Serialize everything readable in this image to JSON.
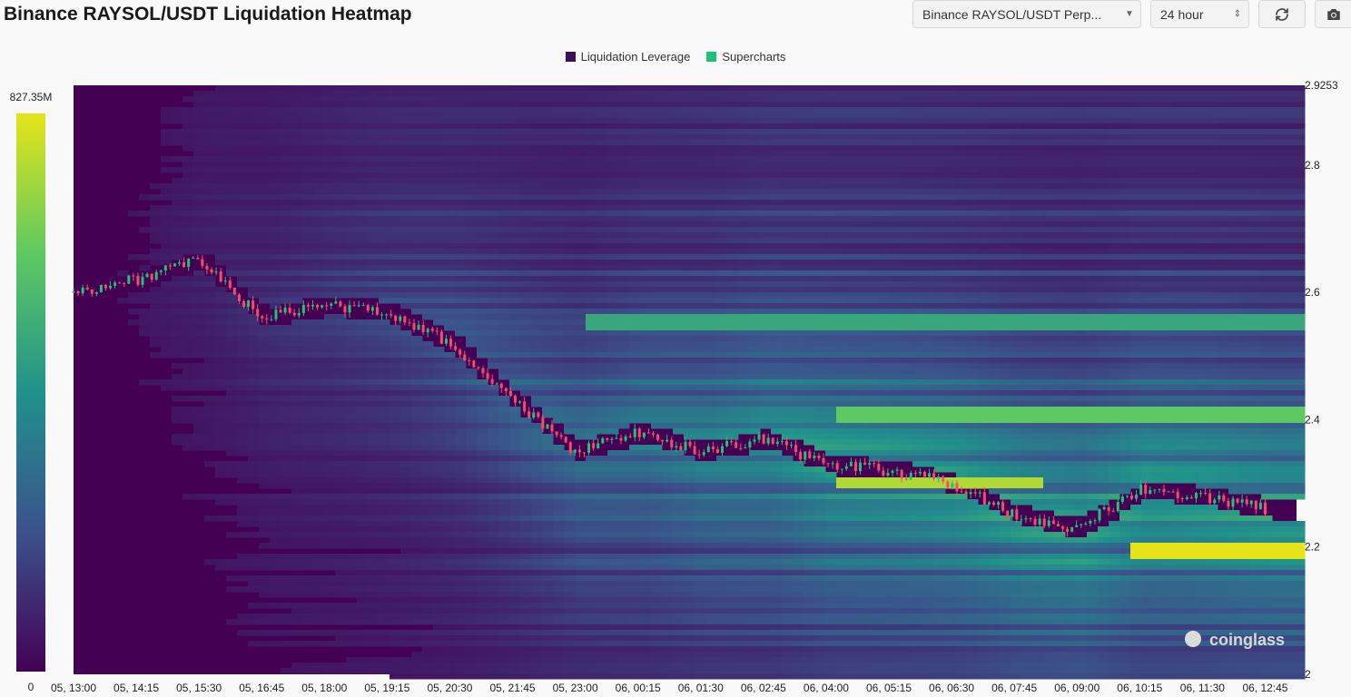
{
  "page_title": "Binance RAYSOL/USDT Liquidation Heatmap",
  "controls": {
    "pair_select": "Binance RAYSOL/USDT Perp...",
    "range_select": "24 hour",
    "refresh_icon": "refresh-icon",
    "camera_icon": "camera-icon"
  },
  "watermark": "coinglass",
  "colors": {
    "legend_leverage": "#3b0f5c",
    "legend_supercharts": "#1ec27a",
    "heat_low": "#440154",
    "heat_high": "#e6e419",
    "candle_up": "#25c07a",
    "candle_down": "#ef4f6d"
  },
  "chart_data": {
    "type": "heatmap",
    "title": "Binance RAYSOL/USDT Liquidation Heatmap",
    "legend": [
      "Liquidation Leverage",
      "Supercharts"
    ],
    "legend_position": "top-center",
    "colorbar": {
      "min_label": "0",
      "max_label": "827.35M",
      "min": 0,
      "max": 827350000
    },
    "x_ticks": [
      "05, 13:00",
      "05, 14:15",
      "05, 15:30",
      "05, 16:45",
      "05, 18:00",
      "05, 19:15",
      "05, 20:30",
      "05, 21:45",
      "05, 23:00",
      "06, 00:15",
      "06, 01:30",
      "06, 02:45",
      "06, 04:00",
      "06, 05:15",
      "06, 06:30",
      "06, 07:45",
      "06, 09:00",
      "06, 10:15",
      "06, 11:30",
      "06, 12:45"
    ],
    "y_ticks": [
      {
        "label": "2.9253",
        "value": 2.9253
      },
      {
        "label": "2.8",
        "value": 2.8
      },
      {
        "label": "2.6",
        "value": 2.6
      },
      {
        "label": "2.4",
        "value": 2.4
      },
      {
        "label": "2.2",
        "value": 2.2
      },
      {
        "label": "2",
        "value": 2.0
      }
    ],
    "y_range": [
      2.0,
      2.9253
    ],
    "price_path": [
      {
        "t": "05, 13:00",
        "price": 2.6
      },
      {
        "t": "05, 14:15",
        "price": 2.62
      },
      {
        "t": "05, 15:30",
        "price": 2.65
      },
      {
        "t": "05, 16:45",
        "price": 2.56
      },
      {
        "t": "05, 18:00",
        "price": 2.58
      },
      {
        "t": "05, 19:15",
        "price": 2.57
      },
      {
        "t": "05, 20:30",
        "price": 2.52
      },
      {
        "t": "05, 21:45",
        "price": 2.43
      },
      {
        "t": "05, 23:00",
        "price": 2.35
      },
      {
        "t": "06, 00:15",
        "price": 2.38
      },
      {
        "t": "06, 01:30",
        "price": 2.35
      },
      {
        "t": "06, 02:45",
        "price": 2.37
      },
      {
        "t": "06, 04:00",
        "price": 2.33
      },
      {
        "t": "06, 05:15",
        "price": 2.32
      },
      {
        "t": "06, 06:30",
        "price": 2.3
      },
      {
        "t": "06, 07:45",
        "price": 2.25
      },
      {
        "t": "06, 09:00",
        "price": 2.23
      },
      {
        "t": "06, 10:15",
        "price": 2.29
      },
      {
        "t": "06, 11:30",
        "price": 2.28
      },
      {
        "t": "06, 12:45",
        "price": 2.26
      }
    ],
    "hot_bands": [
      {
        "price": 2.197,
        "from": "06, 10:00",
        "to": "06, 12:45",
        "intensity": 1.0
      },
      {
        "price": 2.3,
        "from": "06, 04:00",
        "to": "06, 07:30",
        "intensity": 0.9
      },
      {
        "price": 2.41,
        "from": "06, 04:00",
        "to": "06, 12:45",
        "intensity": 0.75
      },
      {
        "price": 2.55,
        "from": "05, 23:00",
        "to": "06, 12:45",
        "intensity": 0.6
      }
    ]
  }
}
